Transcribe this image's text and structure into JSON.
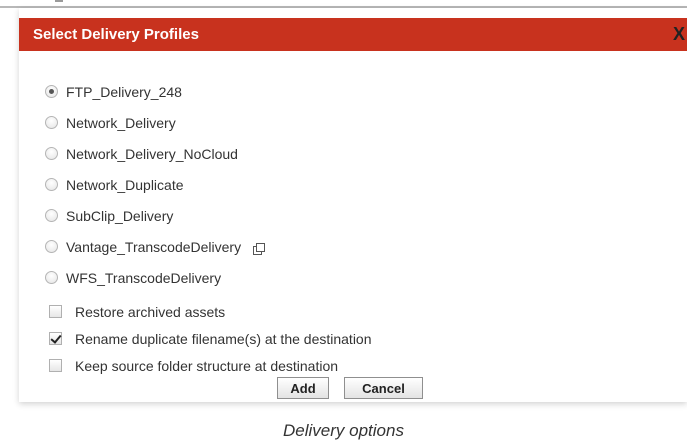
{
  "dialog": {
    "title": "Select Delivery Profiles",
    "close_label": "X"
  },
  "profiles": [
    {
      "label": "FTP_Delivery_248",
      "selected": true
    },
    {
      "label": "Network_Delivery",
      "selected": false
    },
    {
      "label": "Network_Delivery_NoCloud",
      "selected": false
    },
    {
      "label": "Network_Duplicate",
      "selected": false
    },
    {
      "label": "SubClip_Delivery",
      "selected": false
    },
    {
      "label": "Vantage_TranscodeDelivery",
      "selected": false,
      "icon": "external-link-icon"
    },
    {
      "label": "WFS_TranscodeDelivery",
      "selected": false
    }
  ],
  "options": [
    {
      "label": "Restore archived assets",
      "checked": false
    },
    {
      "label": "Rename duplicate filename(s) at the destination",
      "checked": true
    },
    {
      "label": "Keep source folder structure at destination",
      "checked": false
    }
  ],
  "buttons": {
    "add_label": "Add",
    "cancel_label": "Cancel"
  },
  "caption": "Delivery options",
  "colors": {
    "titlebar": "#c8321e",
    "title_text": "#ffffff"
  }
}
